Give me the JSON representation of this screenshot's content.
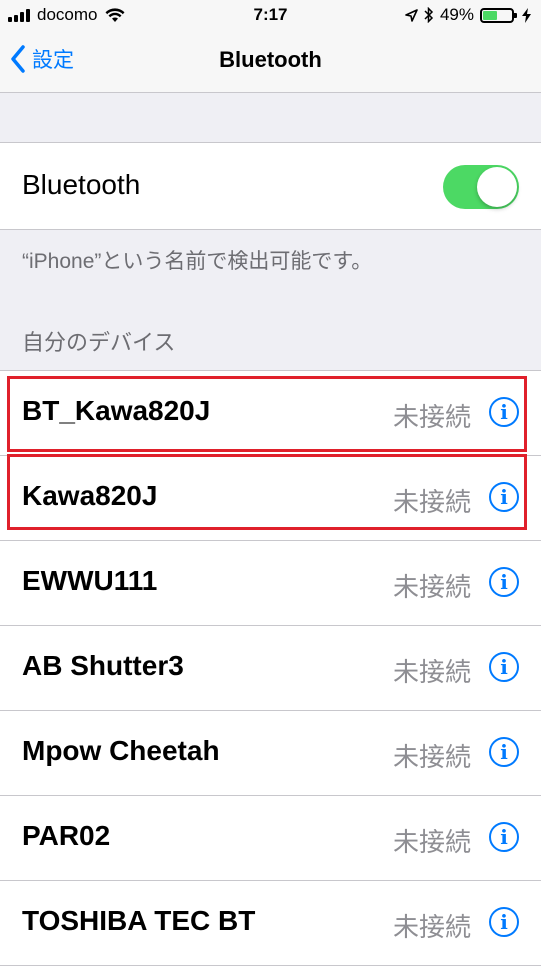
{
  "status_bar": {
    "carrier": "docomo",
    "time": "7:17",
    "battery_percent": "49%",
    "battery_level": 0.49,
    "icons": [
      "signal-icon",
      "wifi-icon",
      "location-icon",
      "bluetooth-icon",
      "battery-icon",
      "charging-icon"
    ]
  },
  "nav": {
    "back_label": "設定",
    "title": "Bluetooth"
  },
  "bluetooth": {
    "label": "Bluetooth",
    "enabled": true,
    "discoverable_text": "“iPhone”という名前で検出可能です。"
  },
  "devices_section": {
    "header": "自分のデバイス",
    "items": [
      {
        "name": "BT_Kawa820J",
        "status": "未接続",
        "highlighted": true
      },
      {
        "name": "Kawa820J",
        "status": "未接続",
        "highlighted": true
      },
      {
        "name": "EWWU111",
        "status": "未接続",
        "highlighted": false
      },
      {
        "name": "AB Shutter3",
        "status": "未接続",
        "highlighted": false
      },
      {
        "name": "Mpow Cheetah",
        "status": "未接続",
        "highlighted": false
      },
      {
        "name": "PAR02",
        "status": "未接続",
        "highlighted": false
      },
      {
        "name": "TOSHIBA TEC BT",
        "status": "未接続",
        "highlighted": false
      }
    ]
  },
  "colors": {
    "accent": "#007aff",
    "toggle_on": "#4cd964",
    "highlight_border": "#e0202b"
  }
}
